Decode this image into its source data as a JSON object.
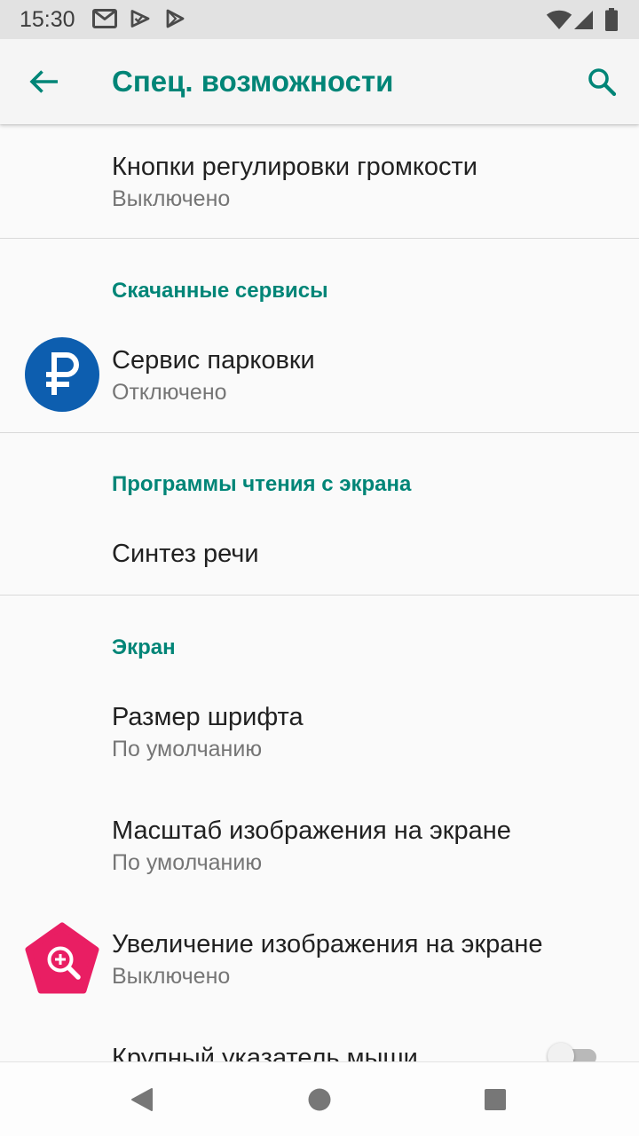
{
  "status_bar": {
    "time": "15:30",
    "notification_icons": [
      "gmail-icon",
      "play-store-update-icon",
      "google-play-icon"
    ],
    "system_icons": [
      "wifi-icon",
      "cell-signal-icon",
      "battery-icon"
    ]
  },
  "app_bar": {
    "title": "Спец. возможности",
    "navigation_icon": "arrow-back-icon",
    "action_icon": "search-icon"
  },
  "settings": {
    "volume_keys": {
      "title": "Кнопки регулировки громкости",
      "summary": "Выключено"
    },
    "downloaded_services": {
      "header": "Скачанные сервисы",
      "parking_service": {
        "title": "Сервис парковки",
        "summary": "Отключено",
        "icon": "ruble-circle-icon"
      }
    },
    "screen_readers": {
      "header": "Программы чтения с экрана",
      "text_to_speech": {
        "title": "Синтез речи"
      }
    },
    "display": {
      "header": "Экран",
      "font_size": {
        "title": "Размер шрифта",
        "summary": "По умолчанию"
      },
      "display_size": {
        "title": "Масштаб изображения на экране",
        "summary": "По умолчанию"
      },
      "magnification": {
        "title": "Увеличение изображения на экране",
        "summary": "Выключено",
        "icon": "magnification-icon"
      },
      "large_mouse_pointer": {
        "title": "Крупный указатель мыши",
        "toggle_on": false
      }
    }
  },
  "navigation_bar": {
    "buttons": [
      "nav-back-icon",
      "nav-home-icon",
      "nav-recents-icon"
    ]
  },
  "colors": {
    "accent": "#008577",
    "text_primary": "#212121",
    "text_secondary": "#757575",
    "parking_icon": "#0d5eaf",
    "magnification_icon": "#e91e63"
  }
}
